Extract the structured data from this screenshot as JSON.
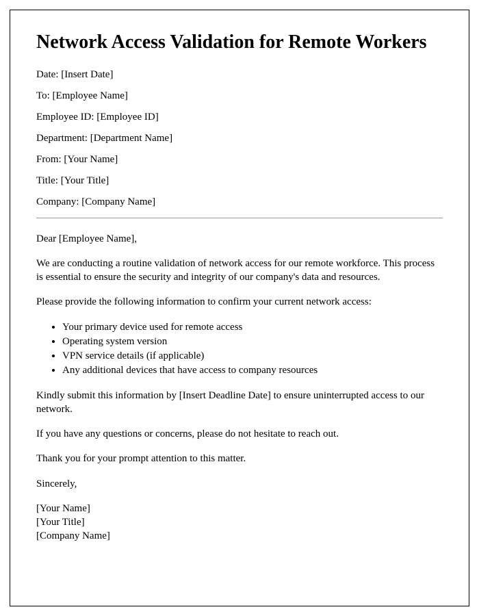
{
  "title": "Network Access Validation for Remote Workers",
  "header": {
    "date": "Date: [Insert Date]",
    "to": "To: [Employee Name]",
    "employee_id": "Employee ID: [Employee ID]",
    "department": "Department: [Department Name]",
    "from": "From: [Your Name]",
    "title": "Title: [Your Title]",
    "company": "Company: [Company Name]"
  },
  "salutation": "Dear [Employee Name],",
  "body": {
    "p1": "We are conducting a routine validation of network access for our remote workforce. This process is essential to ensure the security and integrity of our company's data and resources.",
    "p2": "Please provide the following information to confirm your current network access:",
    "items": {
      "0": "Your primary device used for remote access",
      "1": "Operating system version",
      "2": "VPN service details (if applicable)",
      "3": "Any additional devices that have access to company resources"
    },
    "p3": "Kindly submit this information by [Insert Deadline Date] to ensure uninterrupted access to our network.",
    "p4": "If you have any questions or concerns, please do not hesitate to reach out.",
    "p5": "Thank you for your prompt attention to this matter."
  },
  "closing": "Sincerely,",
  "signature": {
    "name": "[Your Name]",
    "title": "[Your Title]",
    "company": "[Company Name]"
  }
}
